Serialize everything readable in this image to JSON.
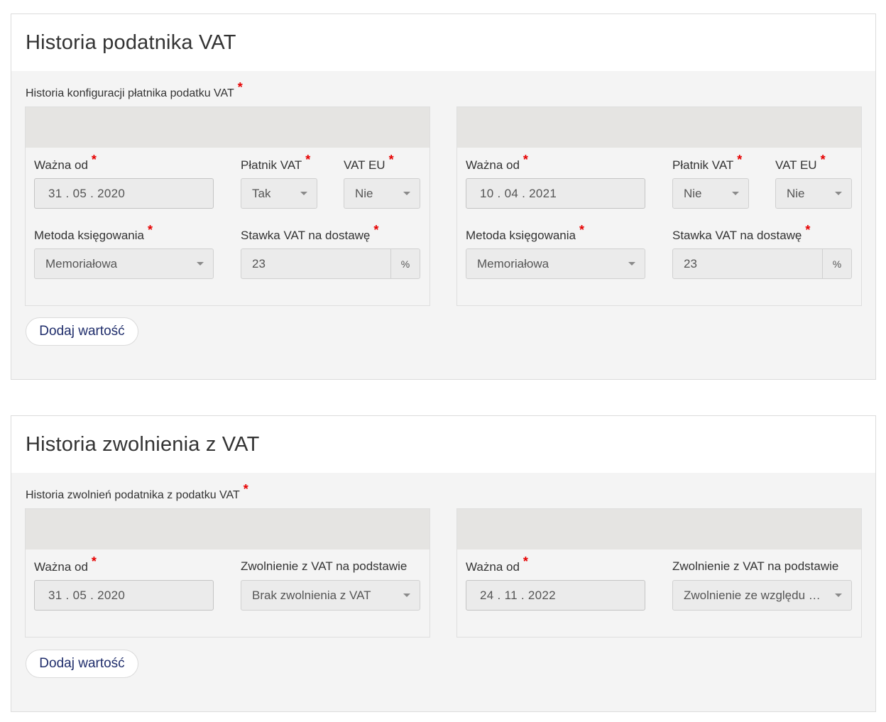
{
  "required_mark": "*",
  "sections": {
    "vat_history": {
      "title": "Historia podatnika VAT",
      "group_label": "Historia konfiguracji płatnika podatku VAT",
      "add_button": "Dodaj wartość",
      "labels": {
        "valid_from": "Ważna od",
        "vat_payer": "Płatnik VAT",
        "vat_eu": "VAT EU",
        "accounting_method": "Metoda księgowania",
        "vat_rate": "Stawka VAT na dostawę"
      },
      "rate_unit": "%",
      "entries": [
        {
          "valid_from": "31 . 05 . 2020",
          "vat_payer": "Tak",
          "vat_eu": "Nie",
          "accounting_method": "Memoriałowa",
          "vat_rate": "23"
        },
        {
          "valid_from": "10 . 04 . 2021",
          "vat_payer": "Nie",
          "vat_eu": "Nie",
          "accounting_method": "Memoriałowa",
          "vat_rate": "23"
        }
      ]
    },
    "exemption_history": {
      "title": "Historia zwolnienia z VAT",
      "group_label": "Historia zwolnień podatnika z podatku VAT",
      "add_button": "Dodaj wartość",
      "labels": {
        "valid_from": "Ważna od",
        "exemption_basis": "Zwolnienie z VAT na podstawie"
      },
      "entries": [
        {
          "valid_from": "31 . 05 . 2020",
          "exemption_basis": "Brak zwolnienia z VAT"
        },
        {
          "valid_from": "24 . 11 . 2022",
          "exemption_basis": "Zwolnienie ze względu na ..."
        }
      ]
    }
  },
  "colors": {
    "required": "#e60000",
    "button_text": "#1f2d6b",
    "card_header": "#e5e4e2",
    "section_bg": "#f4f4f4"
  }
}
